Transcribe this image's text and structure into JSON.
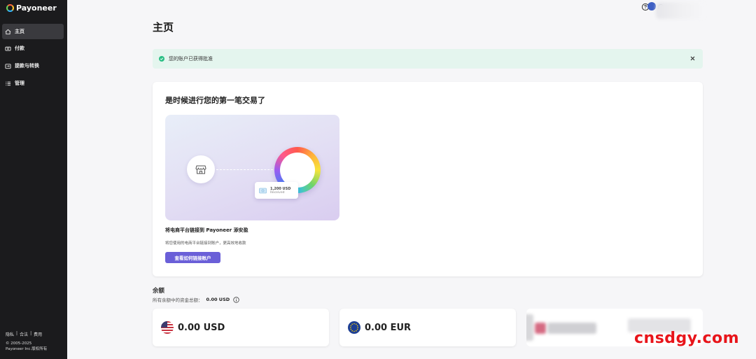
{
  "brand": {
    "name": "Payoneer"
  },
  "sidebar": {
    "items": [
      {
        "label": "主页",
        "icon": "home-icon",
        "active": true
      },
      {
        "label": "付款",
        "icon": "payment-icon"
      },
      {
        "label": "提款与转换",
        "icon": "withdraw-icon"
      },
      {
        "label": "管理",
        "icon": "list-icon"
      }
    ],
    "footer_links": [
      "隐私",
      "合法",
      "费用"
    ],
    "footer_sep": "|",
    "copyright_line1": "© 2005-2025",
    "copyright_line2": "Payoneer Inc.版权所有"
  },
  "page": {
    "title": "主页"
  },
  "banner": {
    "text": "您的账户已获得批准"
  },
  "first_tx": {
    "title": "是时候进行您的第一笔交易了",
    "received_amount": "1,200 USD",
    "received_label": "Received",
    "subtitle": "将电商平台链接到 Payoneer 添安盈",
    "description": "将您使用的电商平台链接到账户，更高效地收款",
    "button": "查看如何链接账户"
  },
  "balance": {
    "title": "余额",
    "total_label": "所有余额中的资金总额：",
    "total_value": "0.00 USD",
    "cards": [
      {
        "amount": "0.00 USD",
        "flag": "us-flag-icon"
      },
      {
        "amount": "0.00 EUR",
        "flag": "eu-flag-icon"
      }
    ]
  },
  "watermark": "cnsdgy.com",
  "colors": {
    "sidebar": "#1b1b1d",
    "accent": "#6a5fd8",
    "success": "#2bbf85",
    "banner_bg": "#e4f5ee",
    "watermark": "#e8141a"
  }
}
